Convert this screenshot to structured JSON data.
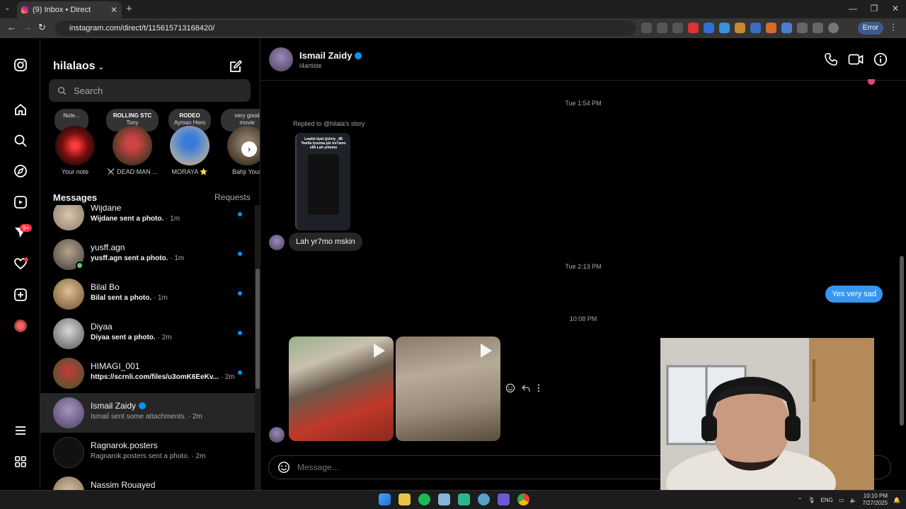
{
  "browser": {
    "tab_title": "(9) Inbox • Direct",
    "url": "instagram.com/direct/t/115615713168420/",
    "error_label": "Error"
  },
  "nav": {
    "notification_badge": "9+"
  },
  "inbox": {
    "username": "hilalaos",
    "search_placeholder": "Search",
    "messages_label": "Messages",
    "requests_label": "Requests",
    "notes": [
      {
        "bubble_line1": "Note...",
        "bubble_line2": "",
        "label": "Your note"
      },
      {
        "bubble_line1": "ROLLING STC",
        "bubble_line2": "Tony",
        "label": "⚔️ DEAD MAN ..."
      },
      {
        "bubble_line1": "RODEO",
        "bubble_line2": "Ayman Hero",
        "label": "MORAYA ⭐"
      },
      {
        "bubble_line1": "very good",
        "bubble_line2": "movie",
        "label": "Bahji Yous"
      }
    ],
    "conversations": [
      {
        "name": "Wijdane",
        "preview": "Wijdane sent a photo.",
        "time": "· 1m",
        "unread": true
      },
      {
        "name": "yusff.agn",
        "preview": "yusff.agn sent a photo.",
        "time": "· 1m",
        "unread": true
      },
      {
        "name": "Bilal Bo",
        "preview": "Bilal sent a photo.",
        "time": "· 1m",
        "unread": true
      },
      {
        "name": "Diyaa",
        "preview": "Diyaa sent a photo.",
        "time": "· 2m",
        "unread": true
      },
      {
        "name": "HIMAGI_001",
        "preview": "https://scrnli.com/files/u3omK6EeKv...",
        "time": "· 2m",
        "unread": true
      },
      {
        "name": "Ismail Zaidy",
        "preview": "Ismail sent some attachments.",
        "time": "· 2m",
        "unread": false
      },
      {
        "name": "Ragnarok.posters",
        "preview": "Ragnarok.posters sent a photo.",
        "time": "· 2m",
        "unread": false
      },
      {
        "name": "Nassim Rouayed",
        "preview": "",
        "time": "",
        "unread": false
      }
    ]
  },
  "chat": {
    "name": "Ismail Zaidy",
    "subtitle": "l4artiste",
    "ts1": "Tue 1:54 PM",
    "replied_to": "Replied to @hilala's story",
    "story_text": "Lwalid dyal @dirty_.88 Twella lyouma pls tre7amo elih Lah yrhemo",
    "msg_in": "Lah yr7mo mskin",
    "ts2": "Tue 2:13 PM",
    "msg_out": "Yes very sad",
    "ts3": "10:08 PM",
    "composer_placeholder": "Message..."
  },
  "taskbar": {
    "lang": "ENG",
    "time": "10:10 PM",
    "date": "7/27/2025"
  }
}
